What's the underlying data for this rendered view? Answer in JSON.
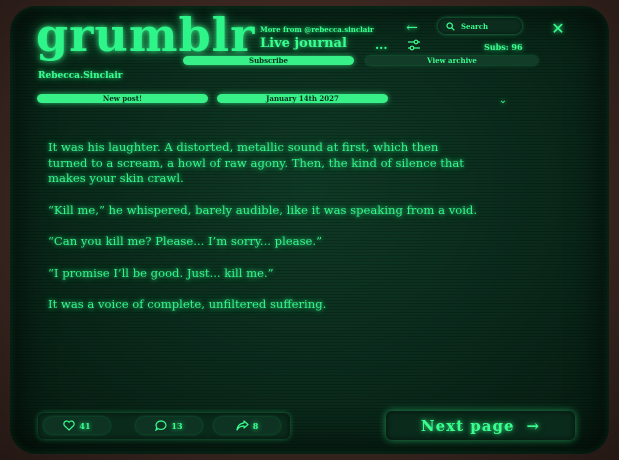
{
  "app": {
    "logo": "grumblr"
  },
  "header": {
    "more_from": "More from @rebecca.sinclair",
    "journal_title": "Live journal",
    "more_menu": "...",
    "search_placeholder": "Search",
    "subs": "Subs: 96"
  },
  "buttons": {
    "subscribe": "Subscribe",
    "view_archive": "View archive",
    "new_post": "New post!",
    "date": "January 14th 2027",
    "next_page": "Next page"
  },
  "author": "Rebecca.Sinclair",
  "story": {
    "paragraphs": [
      "It was his laughter. A distorted, metallic sound at first, which then turned to a scream, a howl of  raw agony. Then, the kind of silence that makes your skin crawl.",
      "“Kill me,”   he whispered, barely audible, like it was speaking from a void.",
      "“Can you kill me?   Please... I’m sorry... please.”",
      "“I promise I’ll be good. Just... kill me.”",
      "It was a voice of complete, unfiltered suffering."
    ]
  },
  "stats": {
    "likes": "41",
    "comments": "13",
    "shares": "8"
  },
  "icons": {
    "back": "arrow-left-icon",
    "settings": "sliders-icon",
    "search": "search-icon",
    "close": "close-icon",
    "chevron": "chevron-down-icon",
    "like": "heart-icon",
    "comment": "comment-icon",
    "share": "share-icon",
    "next": "arrow-right-icon"
  },
  "colors": {
    "accent": "#39ff8f",
    "screen": "#0a2a1b",
    "frame": "#3a2620"
  }
}
